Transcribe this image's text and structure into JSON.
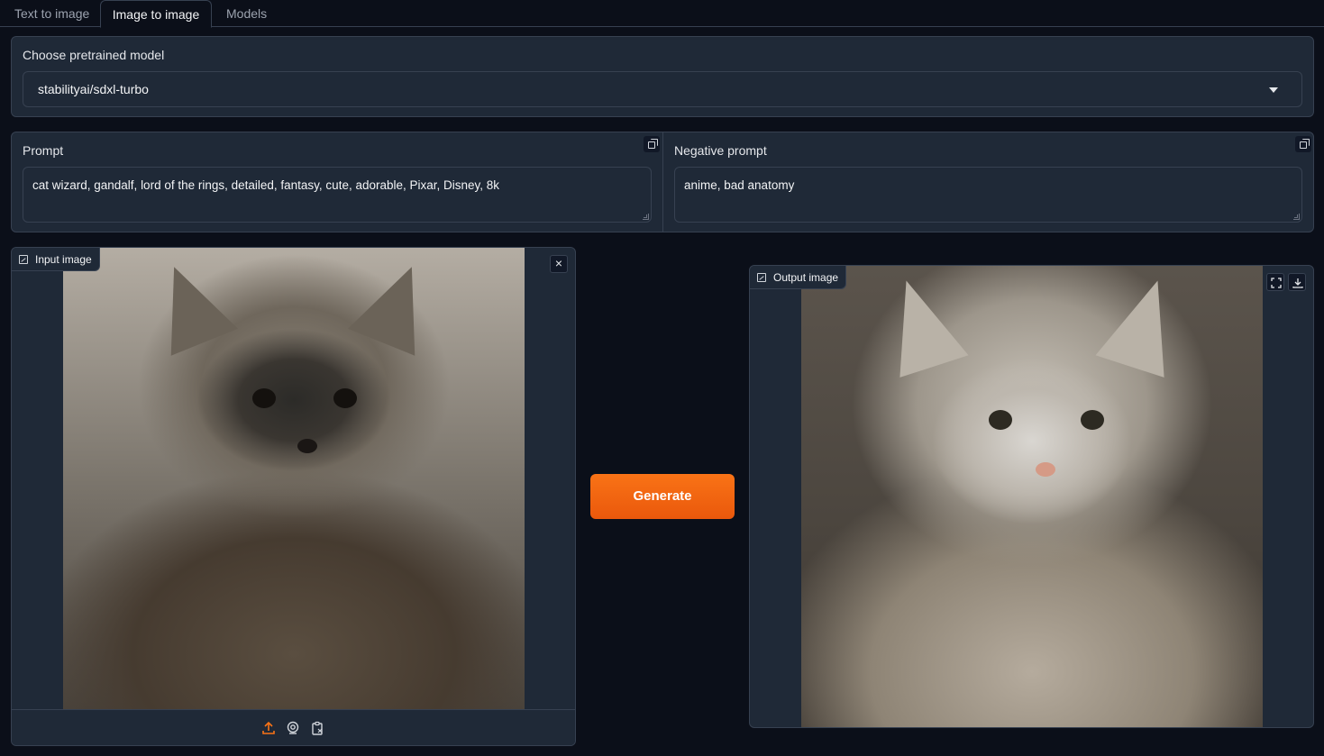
{
  "tabs": [
    {
      "label": "Text to image",
      "active": false
    },
    {
      "label": "Image to image",
      "active": true
    },
    {
      "label": "Models",
      "active": false
    }
  ],
  "model": {
    "label": "Choose pretrained model",
    "selected": "stabilityai/sdxl-turbo"
  },
  "prompt": {
    "label": "Prompt",
    "value": "cat wizard, gandalf, lord of the rings, detailed, fantasy, cute, adorable, Pixar, Disney, 8k"
  },
  "negative_prompt": {
    "label": "Negative prompt",
    "value": "anime, bad anatomy"
  },
  "input_image": {
    "label": "Input image",
    "close_glyph": "×",
    "sources": [
      "upload-icon",
      "webcam-icon",
      "clipboard-icon"
    ]
  },
  "output_image": {
    "label": "Output image",
    "actions": [
      "fullscreen-icon",
      "download-icon"
    ]
  },
  "generate_button": {
    "label": "Generate",
    "color": "#f97316"
  },
  "theme": {
    "background": "#0b0f19",
    "panel": "#1f2937",
    "border": "#374151",
    "accent": "#f97316"
  }
}
